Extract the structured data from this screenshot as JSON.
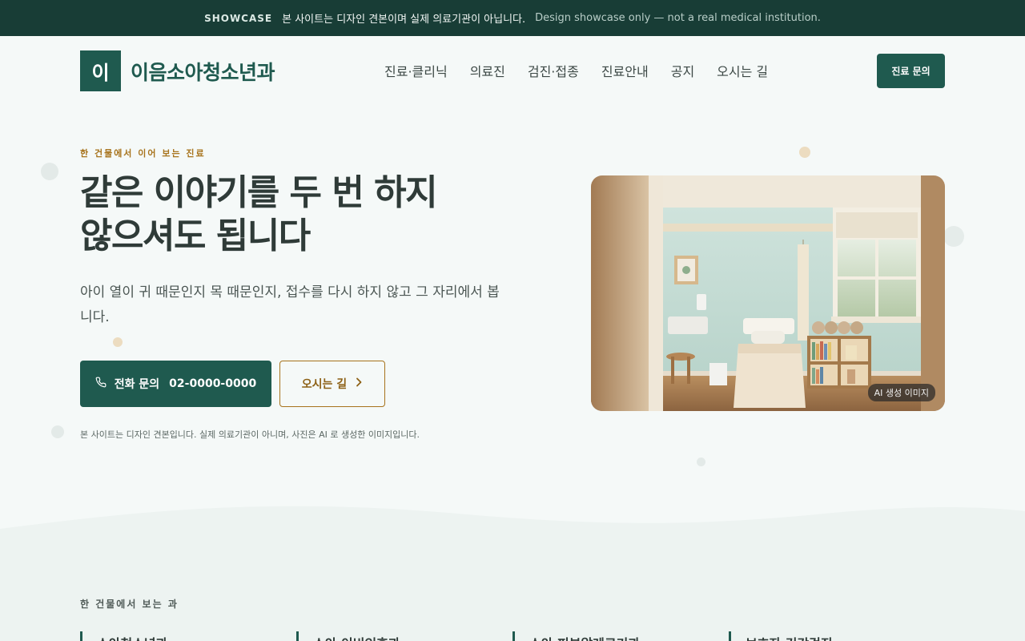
{
  "banner": {
    "tag": "SHOWCASE",
    "ko_notice": "본 사이트는 디자인 견본이며 실제 의료기관이 아닙니다.",
    "en_notice": "Design showcase only — not a real medical institution."
  },
  "header": {
    "logo_mark": "이",
    "logo_text": "이음소아청소년과",
    "nav": [
      "진료·클리닉",
      "의료진",
      "검진·접종",
      "진료안내",
      "공지",
      "오시는 길"
    ],
    "cta": "진료 문의"
  },
  "hero": {
    "eyebrow": "한 건물에서 이어 보는 진료",
    "title_line1": "같은 이야기를 두 번 하지",
    "title_line2": "않으셔도 됩니다",
    "description": "아이 열이 귀 때문인지 목 때문인지, 접수를 다시 하지 않고 그 자리에서 봅니다.",
    "phone_label": "전화 문의",
    "phone_number": "02-0000-0000",
    "directions_label": "오시는 길",
    "disclaimer": "본 사이트는 디자인 견본입니다. 실제 의료기관이 아니며, 사진은 AI 로 생성한 이미지입니다.",
    "image_badge": "AI 생성 이미지"
  },
  "departments": {
    "eyebrow": "한 건물에서 보는 과",
    "cards": [
      "소아청소년과",
      "소아 이비인후과",
      "소아 피부알레르기과",
      "보호자 건강검진"
    ]
  },
  "colors": {
    "brand": "#1f5a4f",
    "accent": "#a7731c",
    "banner": "#183d36",
    "background": "#f5f9f8"
  }
}
